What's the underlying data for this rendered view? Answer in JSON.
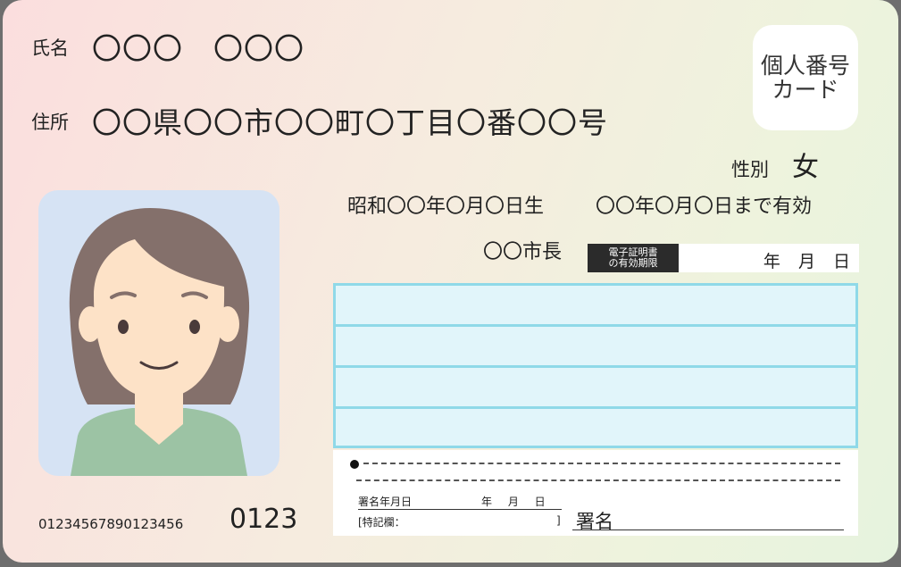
{
  "name": {
    "label": "氏名",
    "value": "〇〇〇　〇〇〇"
  },
  "address": {
    "label": "住所",
    "value": "〇〇県〇〇市〇〇町〇丁目〇番〇〇号"
  },
  "badge": {
    "text": "個人番号\nカード"
  },
  "gender": {
    "label": "性別",
    "value": "女"
  },
  "birth": "昭和〇〇年〇月〇日生",
  "validity": "〇〇年〇月〇日まで有効",
  "issuer": "〇〇市長",
  "cert": {
    "label": "電子証明書\nの有効期限",
    "date": "年 月 日"
  },
  "signature": {
    "date_label": "署名年月日",
    "date_value": "年 月 日",
    "note_label": "[特記欄：",
    "note_close": "]",
    "sign_label": "署名"
  },
  "serial": "01234567890123456",
  "code": "0123",
  "colors": {
    "row_fill": "#e1f5fa",
    "row_border": "#8fd9e8",
    "photo_bg": "#d6e3f4",
    "hair": "#84706b",
    "skin": "#fde2c7",
    "shirt": "#9cc3a4"
  }
}
